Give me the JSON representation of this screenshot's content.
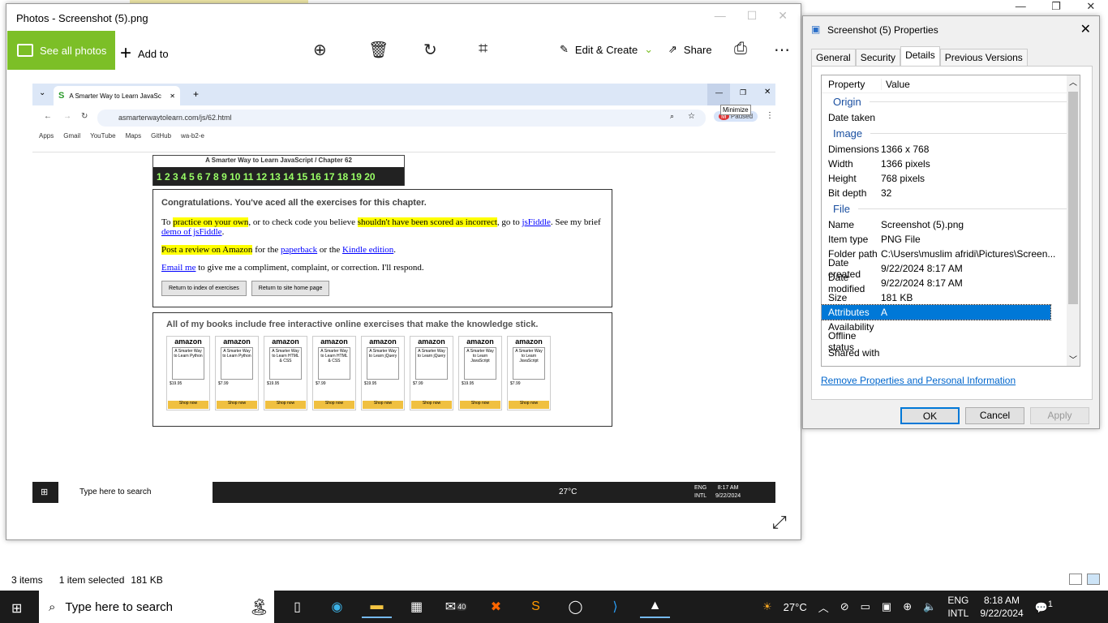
{
  "explorer": {
    "items_count": "3 items",
    "selected": "1 item selected",
    "size": "181 KB"
  },
  "photos": {
    "title": "Photos - Screenshot (5).png",
    "see_all": "See all photos",
    "add_to": "Add to",
    "edit_create": "Edit & Create",
    "share": "Share",
    "more": "⋯"
  },
  "shot": {
    "tab_title": "A Smarter Way to Learn JavaSc",
    "url": "asmarterwaytolearn.com/js/62.html",
    "paused": "Paused",
    "minimize_tip": "Minimize",
    "bookmarks": [
      "Apps",
      "Gmail",
      "YouTube",
      "Maps",
      "GitHub",
      "wa-b2-e"
    ],
    "site_title": "A Smarter Way to Learn JavaScript / Chapter 62",
    "chapter_numbers": "1 2 3 4 5 6 7 8 9 10 11 12 13 14 15 16 17 18 19 20",
    "congrats": "Congratulations. You've aced all the exercises for this chapter.",
    "p1_a": "To ",
    "p1_b": "practice on your own",
    "p1_c": ", or to check code you believe ",
    "p1_d": "shouldn't have been scored as incorrect",
    "p1_e": ", go to ",
    "p1_f": "jsFiddle",
    "p1_g": ". See my brief ",
    "p1_h": "demo of jsFiddle",
    "p1_i": ".",
    "p2_a": "Post a review on Amazon",
    "p2_b": " for the ",
    "p2_c": "paperback",
    "p2_d": " or the ",
    "p2_e": "Kindle edition",
    "p2_f": ".",
    "p3_a": "Email me",
    "p3_b": " to give me a compliment, complaint, or correction. I'll respond.",
    "btn_index": "Return to index of exercises",
    "btn_home": "Return to site home page",
    "books_heading": "All of my books include free interactive online exercises that make the knowledge stick.",
    "books": [
      {
        "title": "A Smarter Way to Learn Python",
        "price": "$19.95"
      },
      {
        "title": "A Smarter Way to Learn Python",
        "price": "$7.99"
      },
      {
        "title": "A Smarter Way to Learn HTML & CSS",
        "price": "$19.95"
      },
      {
        "title": "A Smarter Way to Learn HTML & CSS",
        "price": "$7.99"
      },
      {
        "title": "A Smarter Way to Learn jQuery",
        "price": "$19.95"
      },
      {
        "title": "A Smarter Way to Learn jQuery",
        "price": "$7.99"
      },
      {
        "title": "A Smarter Way to Learn JavaScript",
        "price": "$19.95"
      },
      {
        "title": "A Smarter Way to Learn JavaScript",
        "price": "$7.99"
      }
    ],
    "amazon": "amazon",
    "shop_now": "Shop now",
    "taskbar_search": "Type here to search",
    "temp": "27°C",
    "lang": "ENG",
    "lang2": "INTL",
    "time": "8:17 AM",
    "date": "9/22/2024"
  },
  "props": {
    "title": "Screenshot (5) Properties",
    "tabs": [
      "General",
      "Security",
      "Details",
      "Previous Versions"
    ],
    "col_property": "Property",
    "col_value": "Value",
    "group_origin": "Origin",
    "group_image": "Image",
    "group_file": "File",
    "rows": {
      "date_taken": {
        "k": "Date taken",
        "v": ""
      },
      "dimensions": {
        "k": "Dimensions",
        "v": "1366 x 768"
      },
      "width": {
        "k": "Width",
        "v": "1366 pixels"
      },
      "height": {
        "k": "Height",
        "v": "768 pixels"
      },
      "bit_depth": {
        "k": "Bit depth",
        "v": "32"
      },
      "name": {
        "k": "Name",
        "v": "Screenshot (5).png"
      },
      "item_type": {
        "k": "Item type",
        "v": "PNG File"
      },
      "folder_path": {
        "k": "Folder path",
        "v": "C:\\Users\\muslim afridi\\Pictures\\Screen..."
      },
      "date_created": {
        "k": "Date created",
        "v": "9/22/2024 8:17 AM"
      },
      "date_modified": {
        "k": "Date modified",
        "v": "9/22/2024 8:17 AM"
      },
      "size": {
        "k": "Size",
        "v": "181 KB"
      },
      "attributes": {
        "k": "Attributes",
        "v": "A"
      },
      "availability": {
        "k": "Availability",
        "v": ""
      },
      "offline_status": {
        "k": "Offline status",
        "v": ""
      },
      "shared_with": {
        "k": "Shared with",
        "v": ""
      }
    },
    "remove_link": "Remove Properties and Personal Information",
    "ok": "OK",
    "cancel": "Cancel",
    "apply": "Apply"
  },
  "taskbar": {
    "search": "Type here to search",
    "temp": "27°C",
    "lang": "ENG",
    "lang2": "INTL",
    "time": "8:18 AM",
    "date": "9/22/2024",
    "notifications": "1",
    "mail_badge": "40"
  }
}
